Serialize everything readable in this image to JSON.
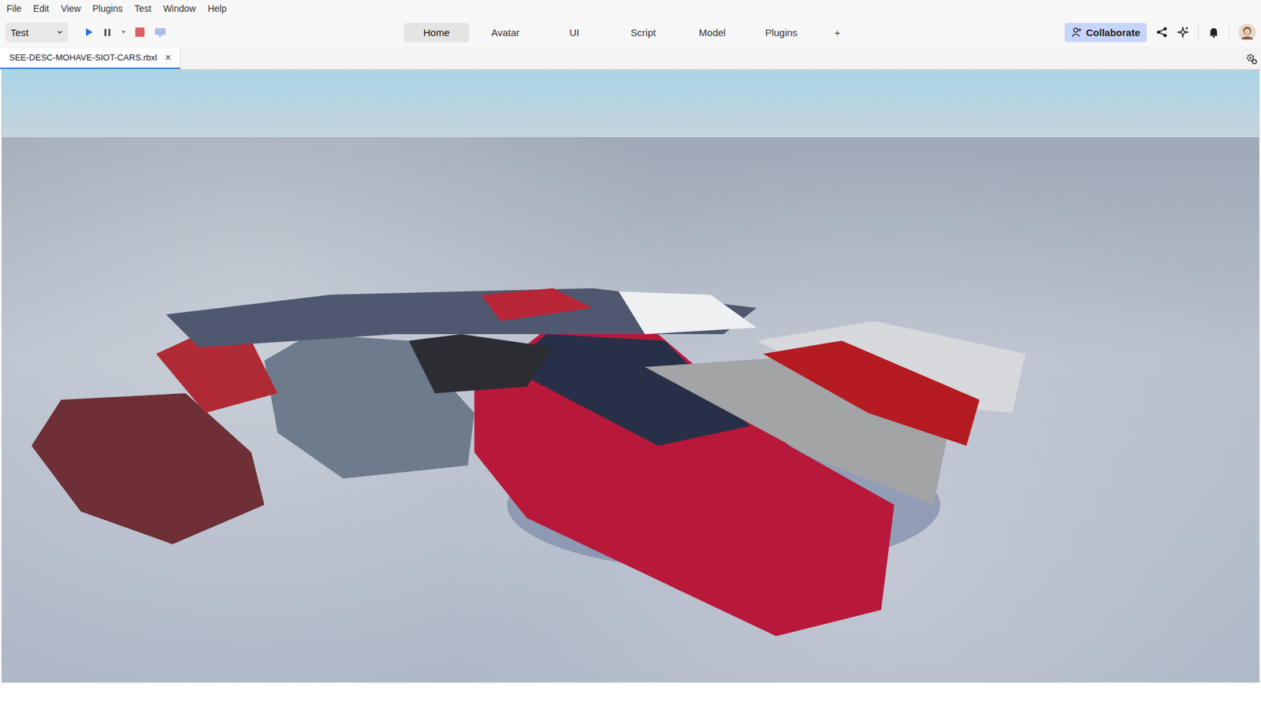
{
  "menu": [
    "File",
    "Edit",
    "View",
    "Plugins",
    "Test",
    "Window",
    "Help"
  ],
  "toolbar": {
    "config_dropdown": {
      "value": "Test"
    },
    "ribbon_tabs": [
      {
        "label": "Home",
        "selected": true
      },
      {
        "label": "Avatar",
        "selected": false
      },
      {
        "label": "UI",
        "selected": false
      },
      {
        "label": "Script",
        "selected": false
      },
      {
        "label": "Model",
        "selected": false
      },
      {
        "label": "Plugins",
        "selected": false
      }
    ],
    "add_tab": "+",
    "collaborate": {
      "label": "Collaborate"
    }
  },
  "document_tabs": [
    {
      "label": "SEE-DESC-MOHAVE-SIOT-CARS.rbxl",
      "close": "×",
      "selected": true
    }
  ]
}
